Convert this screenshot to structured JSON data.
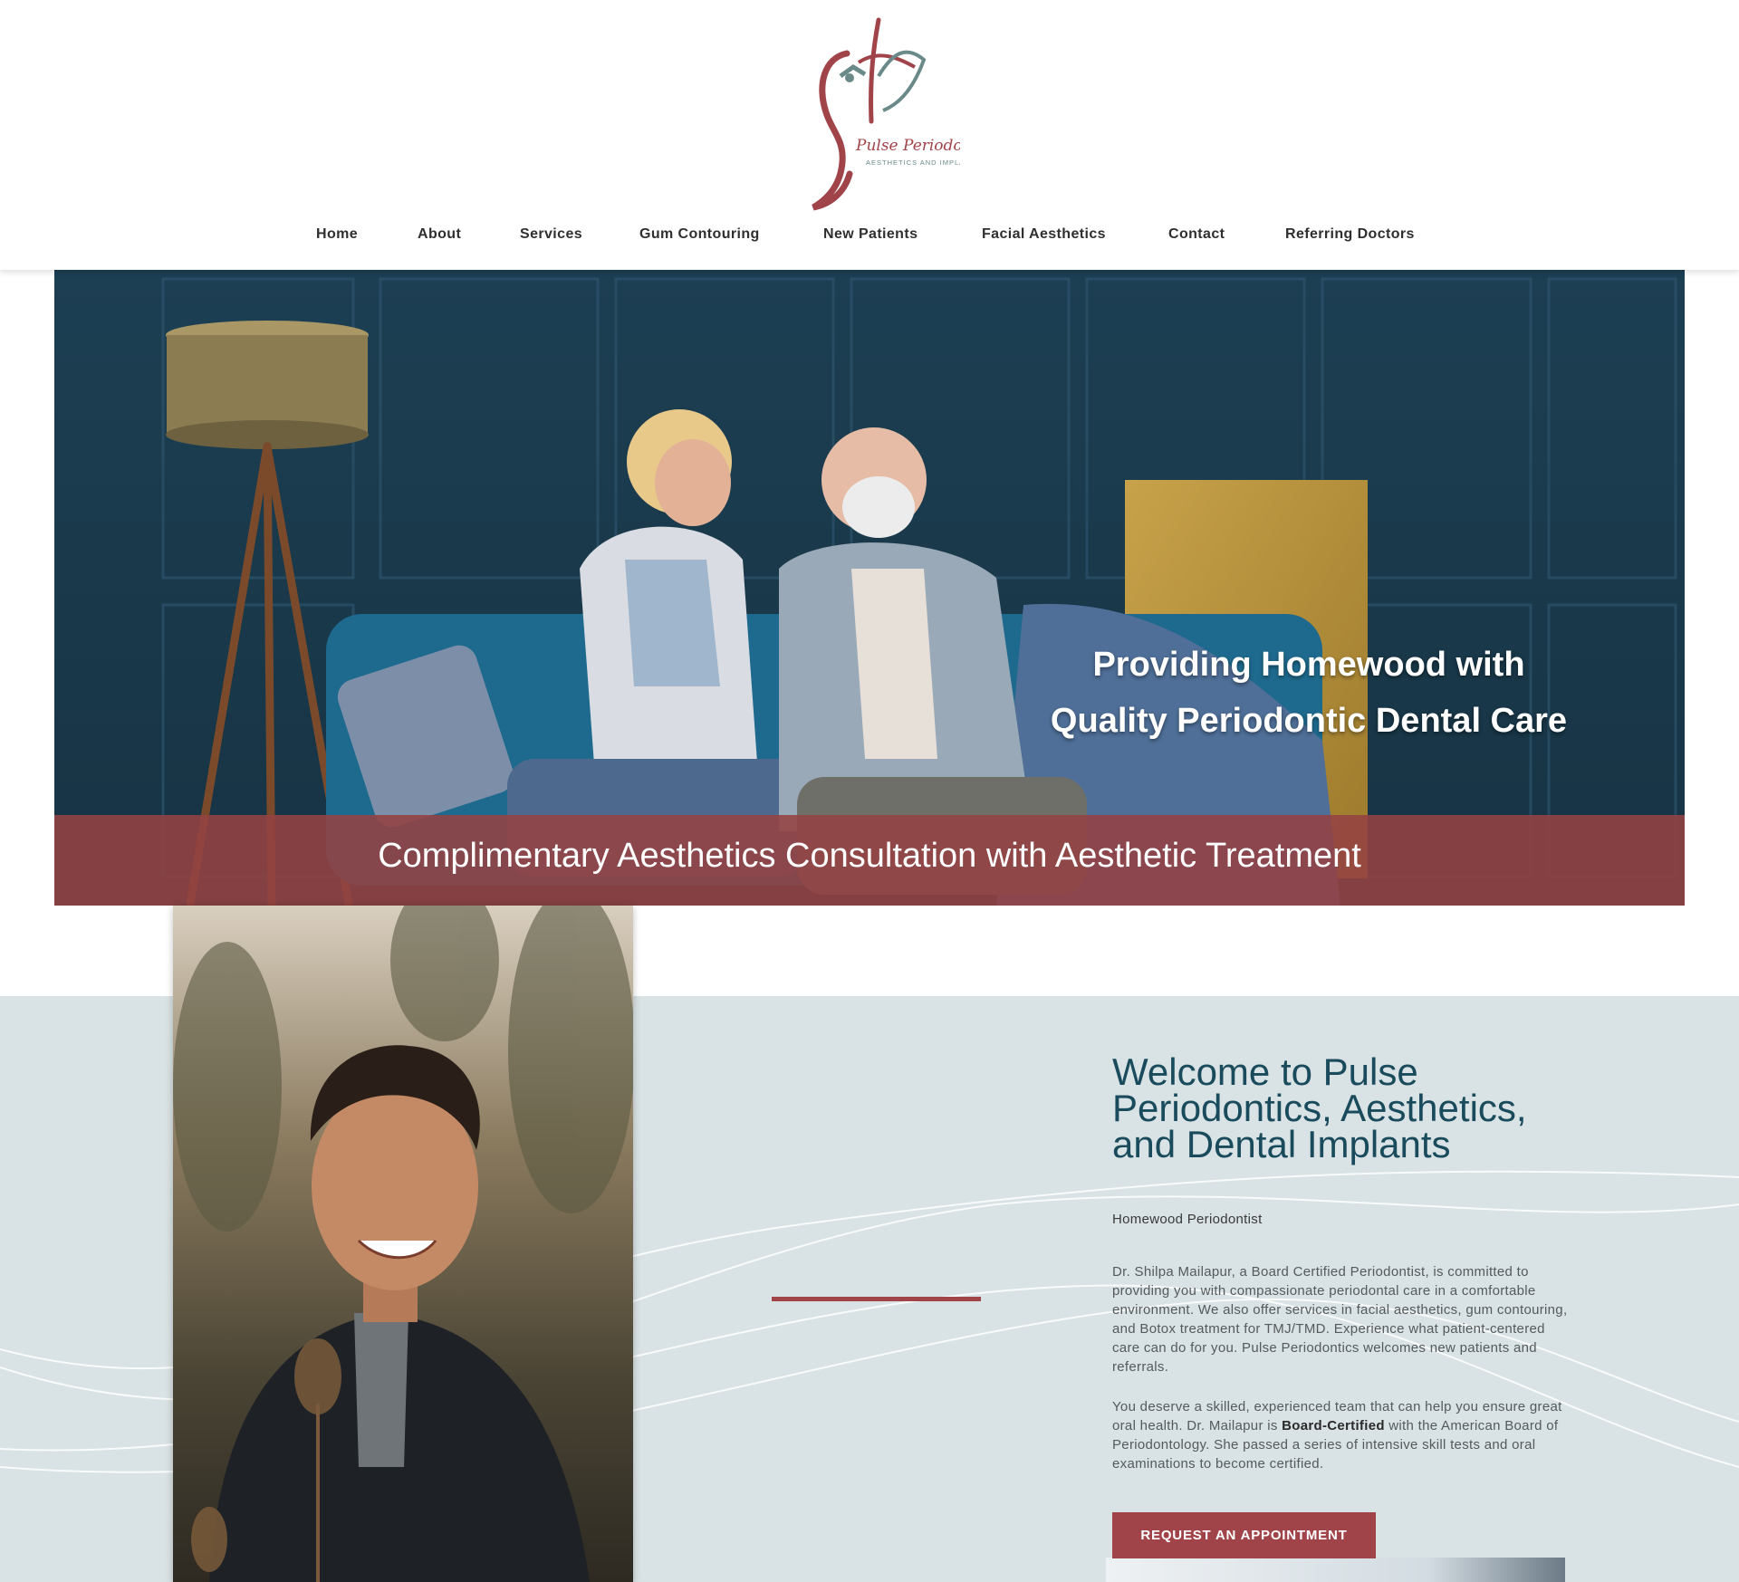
{
  "brand": {
    "name": "Pulse Periodontics",
    "tagline": "AESTHETICS AND IMPLANTS",
    "colors": {
      "maroon": "#a0444a",
      "teal": "#1a4b5c",
      "sage": "#6a8a8a"
    }
  },
  "nav": {
    "items": [
      {
        "label": "Home"
      },
      {
        "label": "About"
      },
      {
        "label": "Services"
      },
      {
        "label": "Gum Contouring"
      },
      {
        "label": "New Patients"
      },
      {
        "label": "Facial Aesthetics"
      },
      {
        "label": "Contact"
      },
      {
        "label": "Referring Doctors"
      }
    ]
  },
  "hero": {
    "heading_line1": "Providing Homewood with",
    "heading_line2": "Quality Periodontic Dental Care",
    "promo": "Complimentary Aesthetics Consultation with Aesthetic Treatment"
  },
  "welcome": {
    "title": "Welcome to Pulse Periodontics, Aesthetics, and Dental Implants",
    "subtitle": "Homewood Periodontist",
    "paragraph1": "Dr. Shilpa Mailapur, a Board Certified Periodontist, is committed to providing you with compassionate periodontal care in a comfortable environment. We also offer services in facial aesthetics, gum contouring, and Botox treatment for TMJ/TMD. Experience what patient-centered care can do for you. Pulse Periodontics welcomes new patients and referrals.",
    "paragraph2_before": "You deserve a skilled, experienced team that can help you ensure great oral health. Dr. Mailapur is ",
    "paragraph2_bold": "Board-Certified",
    "paragraph2_after": " with the American Board of Periodontology. She passed a series of intensive skill tests and oral examinations to become certified.",
    "cta": "REQUEST AN APPOINTMENT"
  }
}
